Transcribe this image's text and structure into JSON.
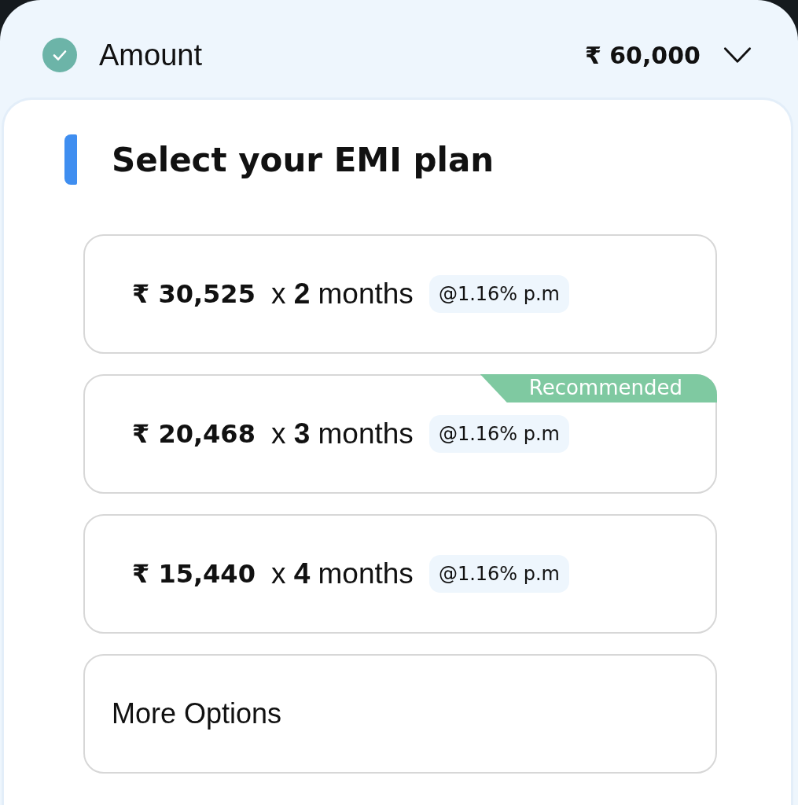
{
  "header": {
    "label": "Amount",
    "completed": true,
    "value": "₹ 60,000",
    "expanded": false
  },
  "section": {
    "title": "Select your EMI plan"
  },
  "plans": [
    {
      "kind": "plan",
      "amount": "₹ 30,525",
      "term": "x **2** months",
      "rate": "@1.16% p.m"
    },
    {
      "kind": "plan",
      "amount": "₹ 20,468",
      "term": "x **3** months",
      "rate": "@1.16% p.m",
      "badge": "Recommended"
    },
    {
      "kind": "plan",
      "amount": "₹ 15,440",
      "term": "x **4** months",
      "rate": "@1.16% p.m"
    },
    {
      "kind": "more",
      "label": "More Options"
    }
  ]
}
